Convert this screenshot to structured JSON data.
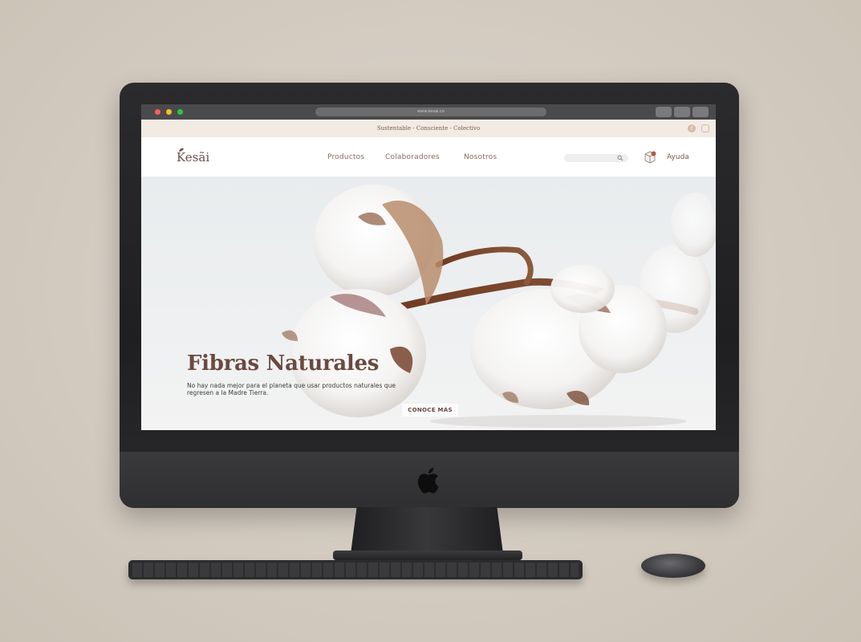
{
  "browser": {
    "url": "www.kesai.co"
  },
  "announcement": {
    "text": "Sustentable - Consciente - Colectivo",
    "facebook_icon": "facebook-icon",
    "instagram_icon": "instagram-icon"
  },
  "nav": {
    "logo": "Kesãi",
    "links": [
      "Productos",
      "Colaboradores",
      "Nosotros"
    ],
    "search_placeholder": "",
    "cart_icon": "package-icon",
    "help": "Ayuda"
  },
  "hero": {
    "title": "Fibras Naturales",
    "text": "No hay nada mejor para el planeta que usar productos naturales que regresen a la Madre Tierra.",
    "cta": "CONOCE MÁS"
  },
  "colors": {
    "brand": "#6a4a40",
    "announce_bg": "#f2ebe4",
    "nav_text": "#8a6a5c",
    "browser_red": "#ff5f57",
    "browser_yellow": "#febc2e",
    "browser_green": "#28c840"
  }
}
